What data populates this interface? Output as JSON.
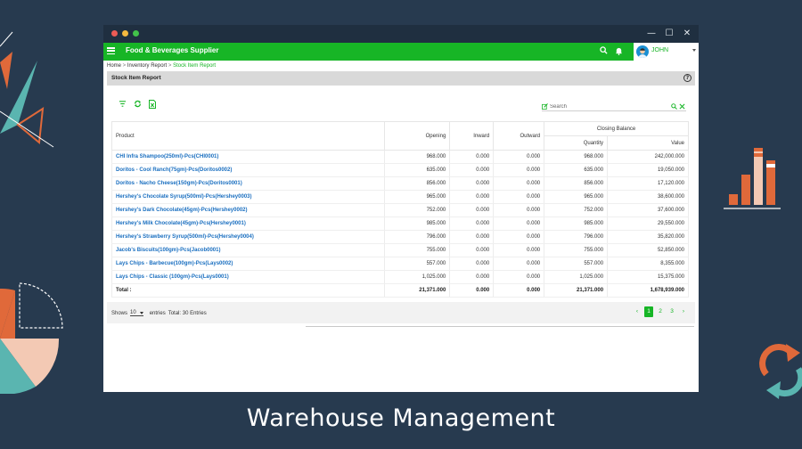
{
  "window": {
    "controls": {
      "minimize": "—",
      "maximize": "☐",
      "close": "✕"
    }
  },
  "appbar": {
    "title": "Food & Beverages Supplier",
    "user": "JOHN"
  },
  "breadcrumb": {
    "home": "Home",
    "report": "Inventory Report",
    "current": "Stock Item Report",
    "sep": " > "
  },
  "section": {
    "title": "Stock Item Report",
    "help": "?"
  },
  "search": {
    "placeholder": "Search"
  },
  "table": {
    "headers": {
      "product": "Product",
      "opening": "Opening",
      "inward": "Inward",
      "outward": "Outward",
      "closing": "Closing Balance",
      "quantity": "Quantity",
      "value": "Value"
    },
    "rows": [
      {
        "product": "CHI Infra Shampoo(250ml)-Pcs(CHI0001)",
        "opening": "968.000",
        "inward": "0.000",
        "outward": "0.000",
        "quantity": "968.000",
        "value": "242,000.000"
      },
      {
        "product": "Doritos - Cool Ranch(75gm)-Pcs(Doritos0002)",
        "opening": "635.000",
        "inward": "0.000",
        "outward": "0.000",
        "quantity": "635.000",
        "value": "19,050.000"
      },
      {
        "product": "Doritos - Nacho Cheese(150gm)-Pcs(Doritos0001)",
        "opening": "856.000",
        "inward": "0.000",
        "outward": "0.000",
        "quantity": "856.000",
        "value": "17,120.000"
      },
      {
        "product": "Hershey's Chocolate Syrup(500ml)-Pcs(Hershey0003)",
        "opening": "965.000",
        "inward": "0.000",
        "outward": "0.000",
        "quantity": "965.000",
        "value": "38,600.000"
      },
      {
        "product": "Hershey's Dark Chocolate(45gm)-Pcs(Hershey0002)",
        "opening": "752.000",
        "inward": "0.000",
        "outward": "0.000",
        "quantity": "752.000",
        "value": "37,600.000"
      },
      {
        "product": "Hershey's Milk Chocolate(45gm)-Pcs(Hershey0001)",
        "opening": "985.000",
        "inward": "0.000",
        "outward": "0.000",
        "quantity": "985.000",
        "value": "29,550.000"
      },
      {
        "product": "Hershey's Strawberry Syrup(500ml)-Pcs(Hershey0004)",
        "opening": "796.000",
        "inward": "0.000",
        "outward": "0.000",
        "quantity": "796.000",
        "value": "35,820.000"
      },
      {
        "product": "Jacob's Biscuits(100gm)-Pcs(Jacob0001)",
        "opening": "755.000",
        "inward": "0.000",
        "outward": "0.000",
        "quantity": "755.000",
        "value": "52,850.000"
      },
      {
        "product": "Lays Chips - Barbecue(100gm)-Pcs(Lays0002)",
        "opening": "557.000",
        "inward": "0.000",
        "outward": "0.000",
        "quantity": "557.000",
        "value": "8,355.000"
      },
      {
        "product": "Lays Chips - Classic (100gm)-Pcs(Lays0001)",
        "opening": "1,025.000",
        "inward": "0.000",
        "outward": "0.000",
        "quantity": "1,025.000",
        "value": "15,375.000"
      }
    ],
    "total": {
      "label": "Total :",
      "opening": "21,371.000",
      "inward": "0.000",
      "outward": "0.000",
      "quantity": "21,371.000",
      "value": "1,678,939.000"
    }
  },
  "footer": {
    "shows_label": "Shows",
    "page_size": "10",
    "entries_label": "entries",
    "total_label": "Total: 30 Entries",
    "pages": [
      "1",
      "2",
      "3"
    ],
    "prev": "‹",
    "next": "›"
  },
  "tagline": "Warehouse Management",
  "colors": {
    "brand": "#17b526",
    "link": "#1a6fc0",
    "background": "#273a4f",
    "accent_orange": "#e0693a",
    "accent_teal": "#5ab5b0"
  }
}
